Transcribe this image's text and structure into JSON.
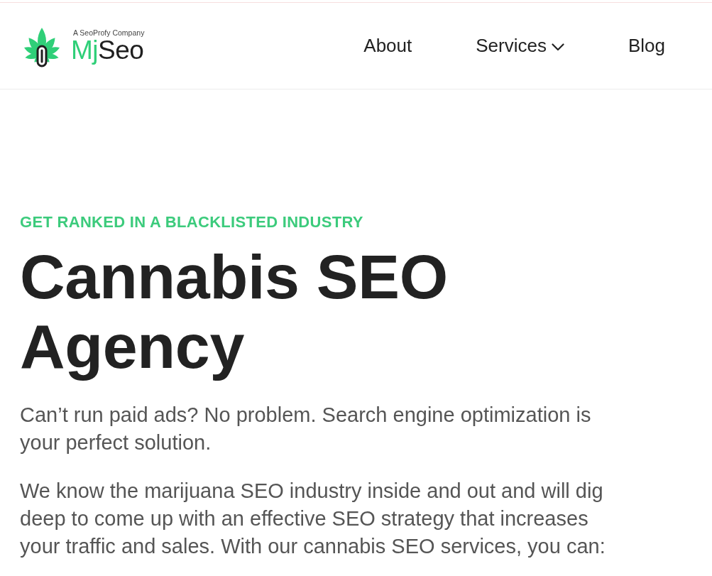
{
  "header": {
    "logo": {
      "tagline": "A SeoProfy Company",
      "wordmark": {
        "accent": "Mj",
        "rest": "Seo"
      }
    },
    "nav": [
      {
        "label": "About",
        "kind": "link"
      },
      {
        "label": "Services",
        "kind": "dropdown"
      },
      {
        "label": "Blog",
        "kind": "link"
      }
    ]
  },
  "hero": {
    "eyebrow": "GET RANKED IN A BLACKLISTED INDUSTRY",
    "title": "Cannabis SEO Agency",
    "paragraphs": [
      "Can’t run paid ads? No problem. Search engine optimization is your perfect solution.",
      "We know the marijuana SEO industry inside and out and will dig deep to come up with an effective SEO strategy that increases your traffic and sales. With our cannabis SEO services, you can:"
    ]
  }
}
